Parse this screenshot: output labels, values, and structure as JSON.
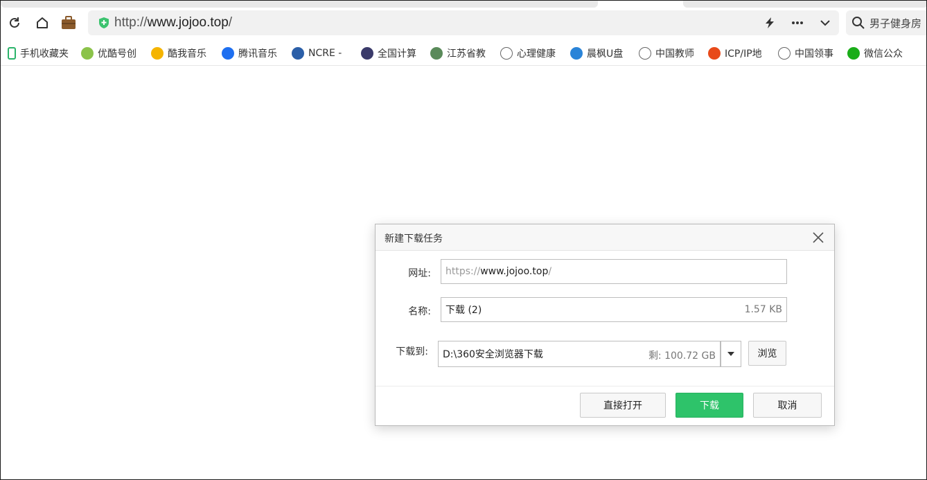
{
  "toolbar": {
    "url_scheme": "http://",
    "url_host": "www.jojoo.top",
    "url_tail": "/",
    "search_text": "男子健身房"
  },
  "bookmarks": [
    {
      "label": "手机收藏夹",
      "icon": "phone-icon",
      "color": "#2ab36a"
    },
    {
      "label": "优酷号创",
      "icon": "leaf-icon",
      "color": "#8bc34a"
    },
    {
      "label": "酷我音乐",
      "icon": "kuwo-icon",
      "color": "#f5b400"
    },
    {
      "label": "腾讯音乐",
      "icon": "tme-icon",
      "color": "#1e6ff0"
    },
    {
      "label": "NCRE -",
      "icon": "ncre-icon",
      "color": "#2b5fa8"
    },
    {
      "label": "全国计算",
      "icon": "eye-icon",
      "color": "#3a3a6a"
    },
    {
      "label": "江苏省教",
      "icon": "jiangsu-icon",
      "color": "#5a8a5a"
    },
    {
      "label": "心理健康",
      "icon": "globe-icon",
      "color": "#666666"
    },
    {
      "label": "晨枫U盘",
      "icon": "chenfeng-icon",
      "color": "#2a84d8"
    },
    {
      "label": "中国教师",
      "icon": "globe-icon",
      "color": "#666666"
    },
    {
      "label": "ICP/IP地",
      "icon": "gear-icon",
      "color": "#e84a1a"
    },
    {
      "label": "中国领事",
      "icon": "globe-icon",
      "color": "#666666"
    },
    {
      "label": "微信公众",
      "icon": "wechat-icon",
      "color": "#1aad19"
    }
  ],
  "dialog": {
    "title": "新建下载任务",
    "url_label": "网址:",
    "url_prefix": "https://",
    "url_host": "www.jojoo.top",
    "url_suffix": "/",
    "name_label": "名称:",
    "name_value": "下载 (2)",
    "size_value": "1.57 KB",
    "path_label": "下载到:",
    "path_value": "D:\\360安全浏览器下载",
    "free_space": "剩: 100.72 GB",
    "browse_label": "浏览",
    "open_label": "直接打开",
    "download_label": "下载",
    "cancel_label": "取消"
  },
  "colors": {
    "accent_green": "#2ec36a",
    "shield_green": "#3cc36f"
  }
}
